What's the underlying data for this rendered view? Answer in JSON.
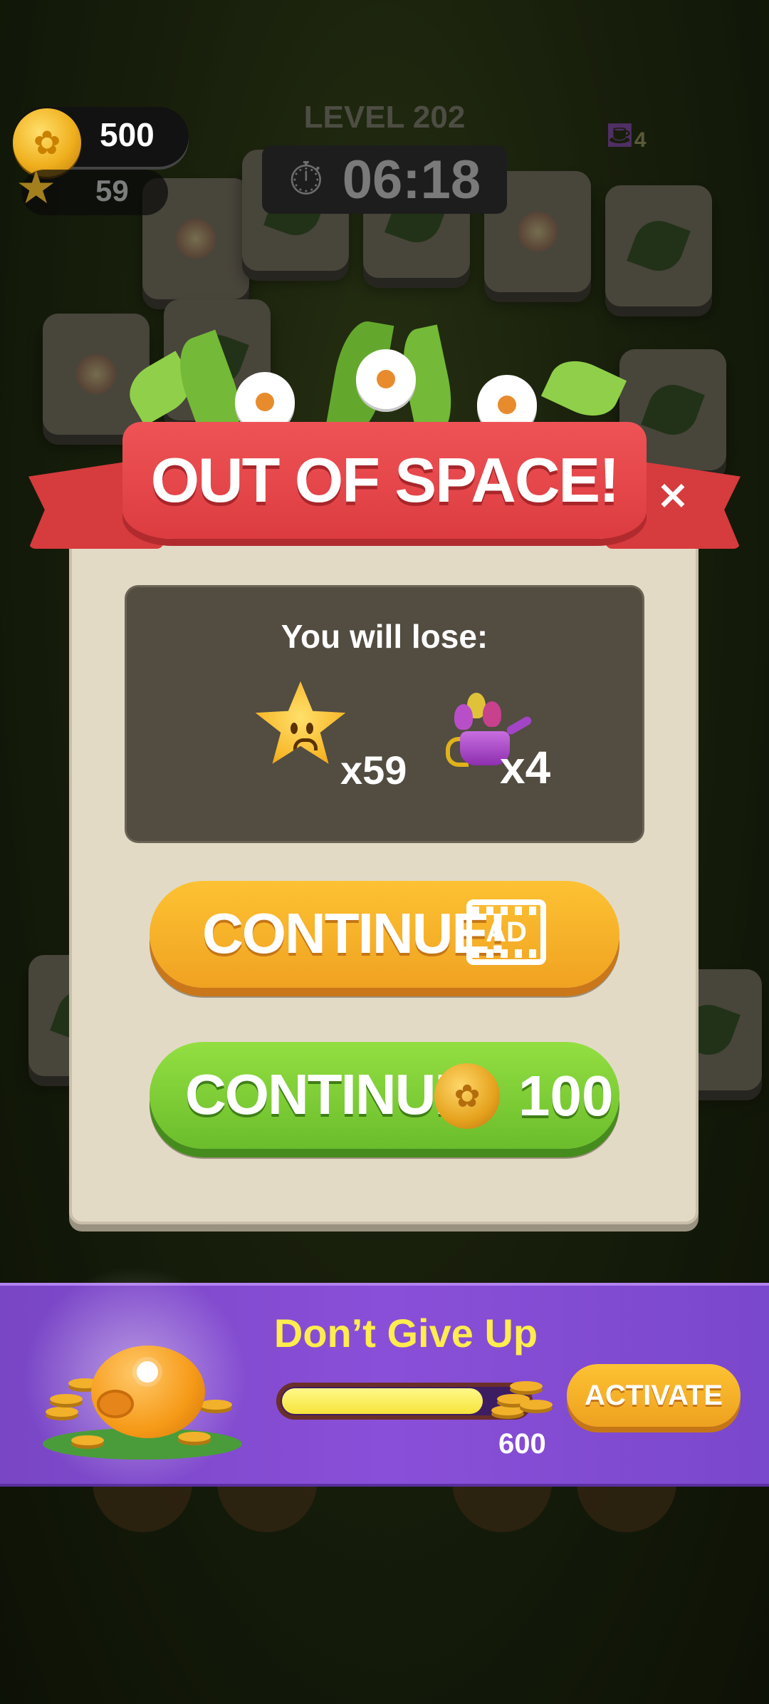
{
  "hud": {
    "coins": "500",
    "stars": "59",
    "level": "LEVEL 202",
    "timer": "06:18",
    "can_badge": "4"
  },
  "modal": {
    "title": "OUT OF SPACE!",
    "close": "×",
    "lose_title": "You will lose:",
    "lose_items": [
      {
        "icon": "sad-star-icon",
        "count": "x59"
      },
      {
        "icon": "watering-can-icon",
        "count": "x4"
      }
    ],
    "continue_ad": {
      "label": "CONTINUE!",
      "badge": "AD"
    },
    "continue_coins": {
      "label": "CONTINUE!",
      "cost": "100"
    }
  },
  "offer": {
    "title": "Don’t Give Up",
    "progress": 0.82,
    "target": "600",
    "button": "ACTIVATE"
  },
  "colors": {
    "ribbon": "#dc3c40",
    "panel": "#524c41",
    "modal_bg": "#e3dac6",
    "orange_button": "#f0a221",
    "green_button": "#6bbd2c",
    "offer_bg": "#8a4fd8",
    "offer_title": "#ffec4d"
  }
}
